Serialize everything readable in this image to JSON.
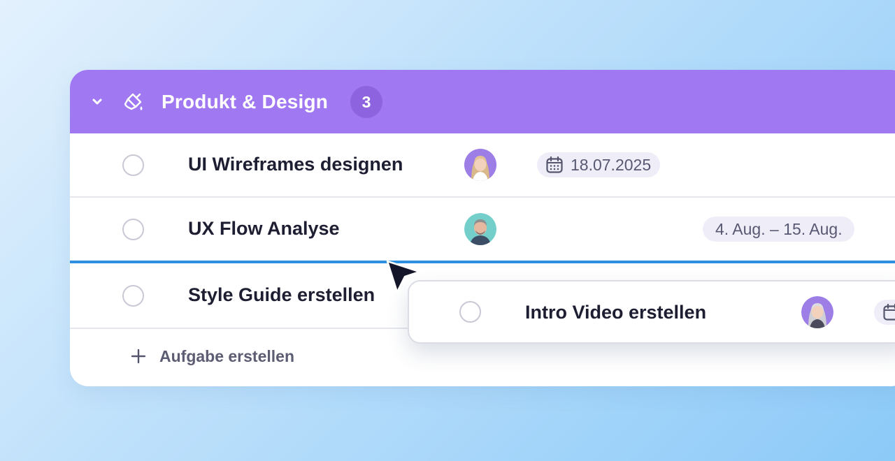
{
  "group": {
    "title": "Produkt & Design",
    "count": "3",
    "collapse_icon": "chevron-down-icon",
    "category_icon": "paint-brush-icon",
    "header_color": "#a078f2"
  },
  "tasks": [
    {
      "name": "UI Wireframes designen",
      "date": "18.07.2025",
      "avatar": "woman-blonde-avatar"
    },
    {
      "name": "UX Flow Analyse",
      "date": "4. Aug. – 15. Aug.",
      "avatar": "man-grey-hair-avatar"
    },
    {
      "name": "Style Guide erstellen"
    }
  ],
  "add_task": {
    "label": "Aufgabe erstellen",
    "icon": "plus-icon"
  },
  "dragged_task": {
    "name": "Intro Video erstellen",
    "avatar": "woman-blonde-avatar"
  },
  "colors": {
    "drop_indicator": "#2f8fe0",
    "chip_bg": "#efeef8"
  }
}
